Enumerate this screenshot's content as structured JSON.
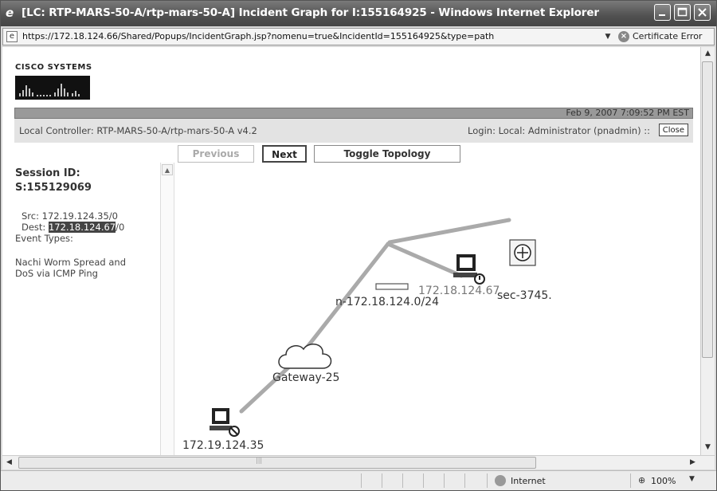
{
  "window": {
    "title": "[LC: RTP-MARS-50-A/rtp-mars-50-A] Incident Graph for I:155164925 - Windows Internet Explorer",
    "url": "https://172.18.124.66/Shared/Popups/IncidentGraph.jsp?nomenu=true&IncidentId=155164925&type=path",
    "cert_label": "Certificate Error"
  },
  "page": {
    "logo_text": "CISCO SYSTEMS",
    "date": "Feb 9, 2007 7:09:52 PM EST",
    "controller": "Local Controller: RTP-MARS-50-A/rtp-mars-50-A v4.2",
    "login": "Login: Local: Administrator (pnadmin) ::",
    "close_label": "Close",
    "nav": {
      "previous": "Previous",
      "next": "Next",
      "toggle": "Toggle Topology"
    }
  },
  "sidebar": {
    "session_label": "Session ID:",
    "session_id": "S:155129069",
    "src": "Src: 172.19.124.35/0",
    "dest_prefix": "Dest: ",
    "dest_ip": "172.18.124.67",
    "dest_suffix": "/0",
    "event_types_label": "Event Types:",
    "event_line1": "Nachi Worm Spread and",
    "event_line2": "DoS via ICMP Ping"
  },
  "graph": {
    "nodes": {
      "source_host": "172.19.124.35",
      "gateway": "Gateway-25",
      "network": "n-172.18.124.0/24",
      "dest_host": "172.18.124.67",
      "router": "sec-3745."
    }
  },
  "statusbar": {
    "zone": "Internet",
    "zoom": "100%"
  }
}
